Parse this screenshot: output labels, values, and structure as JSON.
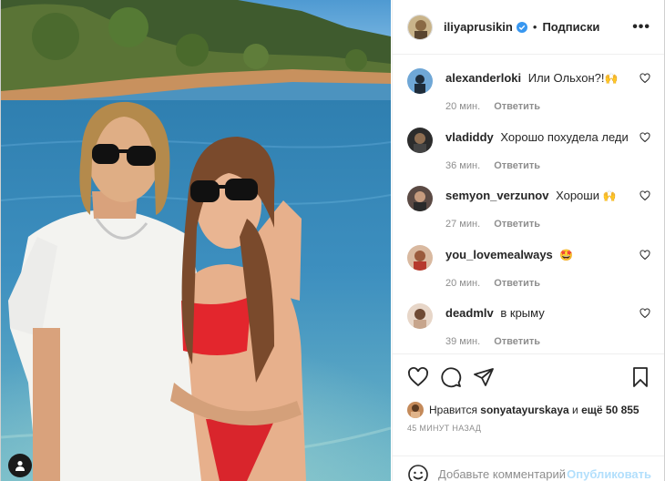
{
  "post": {
    "author": "iliyaprusikin",
    "separator": "•",
    "follow_label": "Подписки",
    "more_label": "•••"
  },
  "comments": [
    {
      "user": "alexanderloki",
      "text": "Или Ольхон?!",
      "emoji": "🙌",
      "time": "20 мин.",
      "reply": "Ответить"
    },
    {
      "user": "vladiddy",
      "text": "Хорошо похудела леди",
      "emoji": "",
      "time": "36 мин.",
      "reply": "Ответить"
    },
    {
      "user": "semyon_verzunov",
      "text": "Хороши",
      "emoji": "🙌",
      "time": "27 мин.",
      "reply": "Ответить"
    },
    {
      "user": "you_lovemealways",
      "text": "",
      "emoji": "🤩",
      "time": "20 мин.",
      "reply": "Ответить"
    },
    {
      "user": "deadmlv",
      "text": "в крыму",
      "emoji": "",
      "time": "39 мин.",
      "reply": "Ответить"
    }
  ],
  "likes": {
    "prefix": "Нравится",
    "user": "sonyatayurskaya",
    "middle": "и",
    "others": "ещё 50 855"
  },
  "timestamp": "45 МИНУТ НАЗАД",
  "add_comment": {
    "placeholder": "Добавьте комментарий...",
    "publish_label": "Опубликовать"
  },
  "icons": {
    "verified": "verified-badge-icon",
    "like": "heart-icon",
    "comment": "comment-bubble-icon",
    "share": "paper-plane-icon",
    "save": "bookmark-icon",
    "emoji": "smiley-icon",
    "tagged": "person-tag-icon"
  },
  "colors": {
    "verified": "#3897f0",
    "publish_disabled": "#b2dffc",
    "meta_text": "#8e8e8e"
  }
}
